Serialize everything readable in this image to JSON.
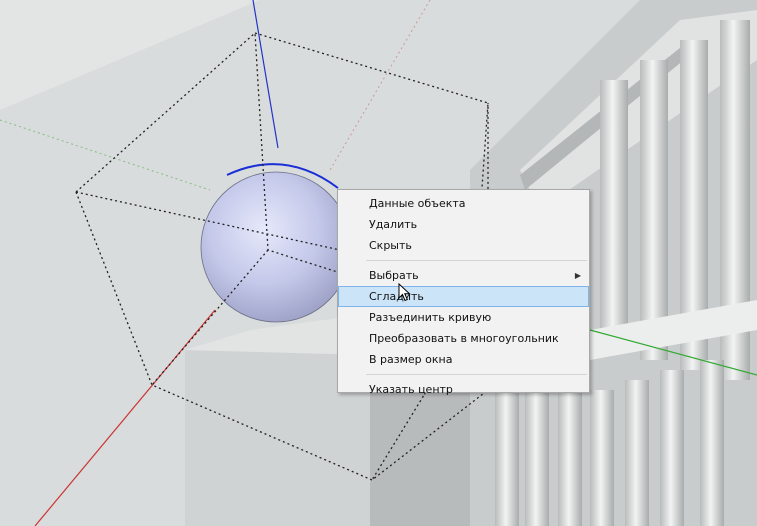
{
  "context_menu": {
    "items": [
      {
        "label": "Данные объекта"
      },
      {
        "label": "Удалить"
      },
      {
        "label": "Скрыть"
      },
      {
        "label": "Выбрать",
        "has_submenu": true
      },
      {
        "label": "Сгладить",
        "selected": true
      },
      {
        "label": "Разъединить кривую"
      },
      {
        "label": "Преобразовать в многоугольник"
      },
      {
        "label": "В размер окна"
      },
      {
        "label": "Указать центр"
      }
    ]
  },
  "icons": {
    "submenu_arrow": "chevron-right-icon",
    "cursor": "mouse-pointer-icon"
  },
  "colors": {
    "axis_blue": "#2233cc",
    "axis_red": "#cc3333",
    "axis_green": "#33aa33",
    "menu_highlight": "#cce4f7",
    "sphere": "#c2c6e6"
  }
}
